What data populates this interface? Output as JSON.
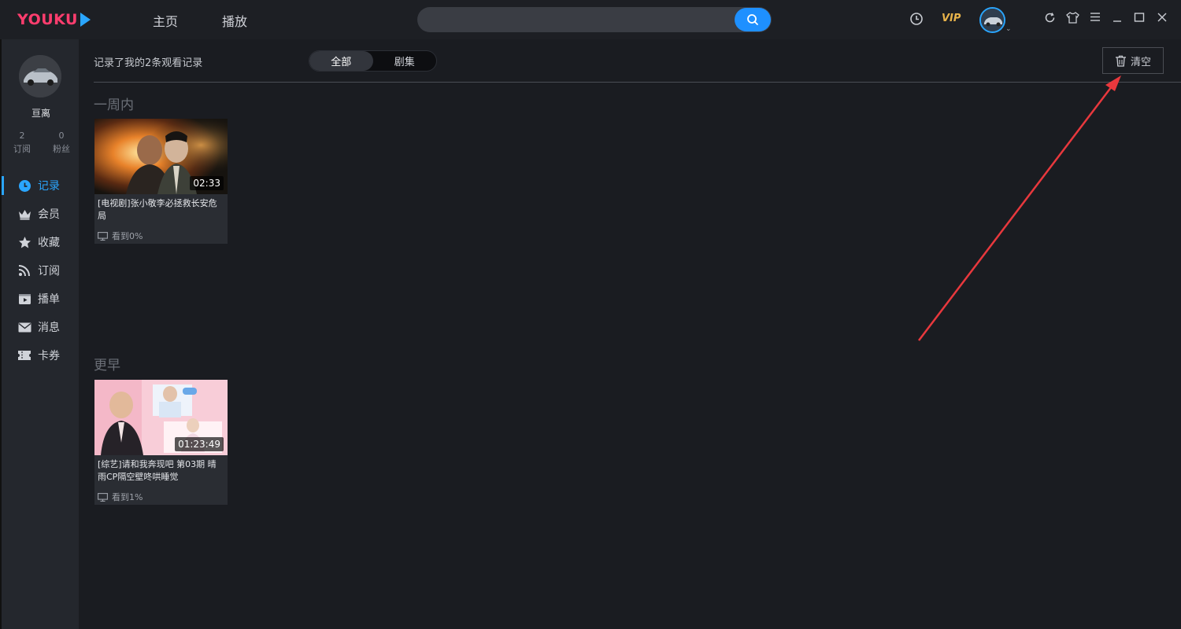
{
  "app": {
    "logo_text": "YOUKU",
    "nav": {
      "home": "主页",
      "play": "播放"
    },
    "search": {
      "placeholder": ""
    },
    "vip_label": "VIP",
    "accent_color": "#2aa6ff",
    "brand_color": "#ff3d6e",
    "icons": [
      "clock-icon",
      "refresh-icon",
      "skin-icon",
      "menu-icon",
      "minimize-icon",
      "maximize-icon",
      "close-icon"
    ]
  },
  "sidebar": {
    "user_name": "亘离",
    "stats": [
      {
        "count": "2",
        "label": "订阅"
      },
      {
        "count": "0",
        "label": "粉丝"
      }
    ],
    "menu": [
      {
        "label": "记录",
        "icon": "clock-icon",
        "active": true
      },
      {
        "label": "会员",
        "icon": "crown-icon"
      },
      {
        "label": "收藏",
        "icon": "star-icon"
      },
      {
        "label": "订阅",
        "icon": "rss-icon"
      },
      {
        "label": "播单",
        "icon": "playlist-icon"
      },
      {
        "label": "消息",
        "icon": "mail-icon"
      },
      {
        "label": "卡券",
        "icon": "ticket-icon"
      }
    ]
  },
  "main": {
    "record_count_text": "记录了我的2条观看记录",
    "filter_tabs": [
      {
        "label": "全部",
        "active": true
      },
      {
        "label": "剧集"
      }
    ],
    "clear_label": "清空",
    "sections": [
      {
        "title": "一周内",
        "items": [
          {
            "title": "[电视剧]张小敬李必拯救长安危局",
            "duration": "02:33",
            "progress": "看到0%"
          }
        ]
      },
      {
        "title": "更早",
        "items": [
          {
            "title": "[综艺]请和我奔现吧 第03期 晴雨CP隔空壁咚哄睡觉",
            "duration": "01:23:49",
            "progress": "看到1%"
          }
        ]
      }
    ]
  }
}
